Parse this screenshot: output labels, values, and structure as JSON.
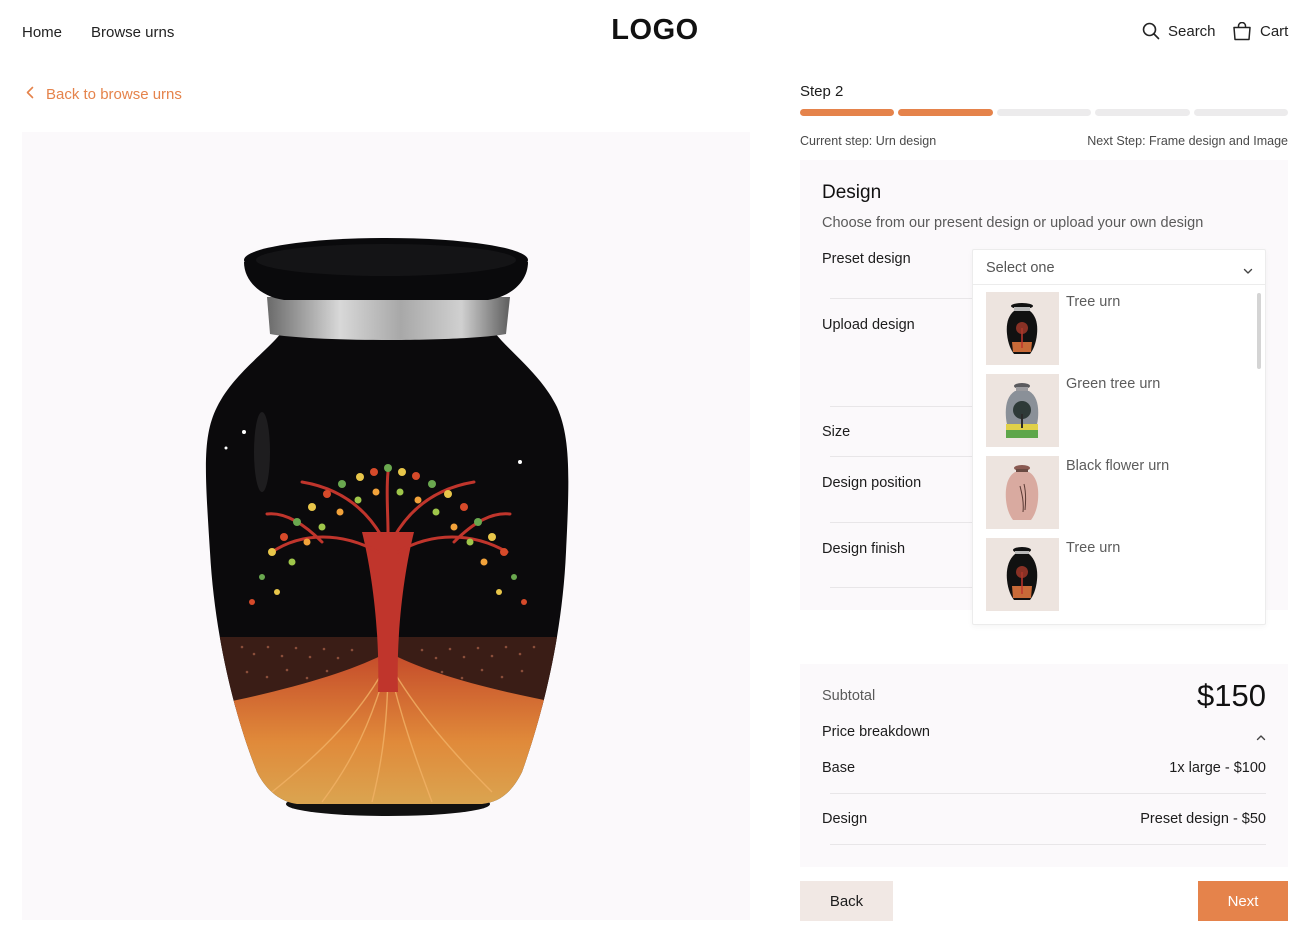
{
  "header": {
    "nav": [
      {
        "label": "Home"
      },
      {
        "label": "Browse urns"
      }
    ],
    "logo": "LOGO",
    "search_label": "Search",
    "cart_label": "Cart",
    "search_icon": "search-icon",
    "cart_icon": "shopping-bag-icon"
  },
  "back_link": {
    "label": "Back to browse urns",
    "icon": "chevron-left-icon"
  },
  "product_image": {
    "description_icon": "urn-image"
  },
  "progress": {
    "step_label": "Step 2",
    "current_step": 2,
    "total_steps": 5,
    "current_text": "Current step: Urn design",
    "next_text": "Next Step: Frame design and Image"
  },
  "design": {
    "title": "Design",
    "subtitle": "Choose from our present design or upload your own design",
    "rows": [
      {
        "label": "Preset design"
      },
      {
        "label": "Upload design"
      },
      {
        "label": "Size"
      },
      {
        "label": "Design position"
      },
      {
        "label": "Design finish"
      }
    ],
    "dropdown": {
      "placeholder": "Select one",
      "options": [
        {
          "name": "Tree urn"
        },
        {
          "name": "Green tree urn"
        },
        {
          "name": "Black flower urn"
        },
        {
          "name": "Tree urn"
        }
      ]
    }
  },
  "summary": {
    "subtotal_label": "Subtotal",
    "subtotal_value": "$150",
    "breakdown_label": "Price breakdown",
    "lines": [
      {
        "label": "Base",
        "value": "1x large - $100"
      },
      {
        "label": "Design",
        "value": "Preset design - $50"
      }
    ]
  },
  "buttons": {
    "back": "Back",
    "next": "Next"
  },
  "colors": {
    "accent": "#e5834b",
    "panel_bg": "#fbf9fb",
    "back_button_bg": "#f1e8e4"
  }
}
